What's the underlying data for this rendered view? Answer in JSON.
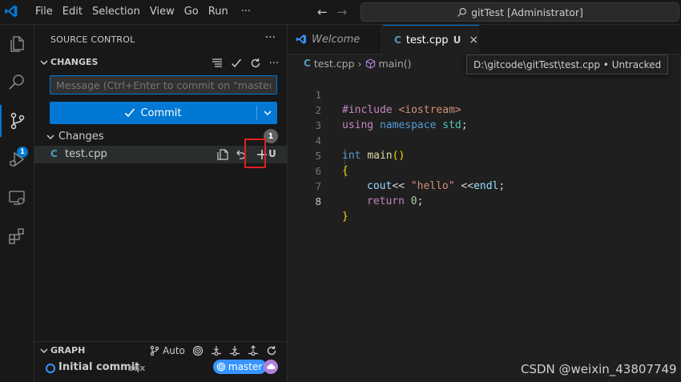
{
  "titlebar": {
    "menu": [
      "File",
      "Edit",
      "Selection",
      "View",
      "Go",
      "Run"
    ],
    "more": "···",
    "command_center": "gitTest [Administrator]"
  },
  "activitybar": {
    "icons": [
      "explorer-icon",
      "search-icon",
      "source-control-icon",
      "run-debug-icon",
      "remote-explorer-icon",
      "extensions-icon"
    ],
    "scm_badge": "1"
  },
  "sidebar": {
    "title": "SOURCE CONTROL",
    "more": "···",
    "section_changes": "CHANGES",
    "commit_placeholder": "Message (Ctrl+Enter to commit on \"master\")",
    "commit_label": "Commit",
    "changes_group": "Changes",
    "changes_count": "1",
    "files": [
      {
        "icon": "C",
        "name": "test.cpp",
        "status": "U"
      }
    ],
    "graph": {
      "title": "GRAPH",
      "auto": "Auto",
      "commit_message": "Initial commit",
      "author": "zqx",
      "branch": "master"
    }
  },
  "editor": {
    "tabs": [
      {
        "label": "Welcome",
        "active": false
      },
      {
        "label": "test.cpp",
        "status": "U",
        "close": "×",
        "active": true
      }
    ],
    "breadcrumbs": [
      "test.cpp",
      "main()"
    ],
    "tooltip": "D:\\gitcode\\gitTest\\test.cpp • Untracked",
    "line_numbers": [
      "1",
      "2",
      "3",
      "4",
      "5",
      "6",
      "7",
      "8"
    ],
    "current_line": "8",
    "code": {
      "l1": {
        "pp": "#include ",
        "inc": "<iostream>"
      },
      "l2": {
        "kw1": "using",
        "kw2": "namespace",
        "ns": "std",
        "semi": ";"
      },
      "l4": {
        "type": "int",
        "fn": "main",
        "paren": "()"
      },
      "l5": {
        "brace": "{"
      },
      "l6": {
        "id": "cout",
        "op": "<< ",
        "str": "\"hello\"",
        "op2": " <<",
        "id2": "endl",
        "semi": ";"
      },
      "l7": {
        "kw": "return",
        "num": "0",
        "semi": ";"
      },
      "l8": {
        "brace": "}"
      }
    }
  },
  "watermark": "CSDN @weixin_43807749",
  "colors": {
    "accent": "#0078d4",
    "highlight_box": "#e02020",
    "branch_pill": "#3794ff",
    "cloud_pill": "#b180d7"
  }
}
